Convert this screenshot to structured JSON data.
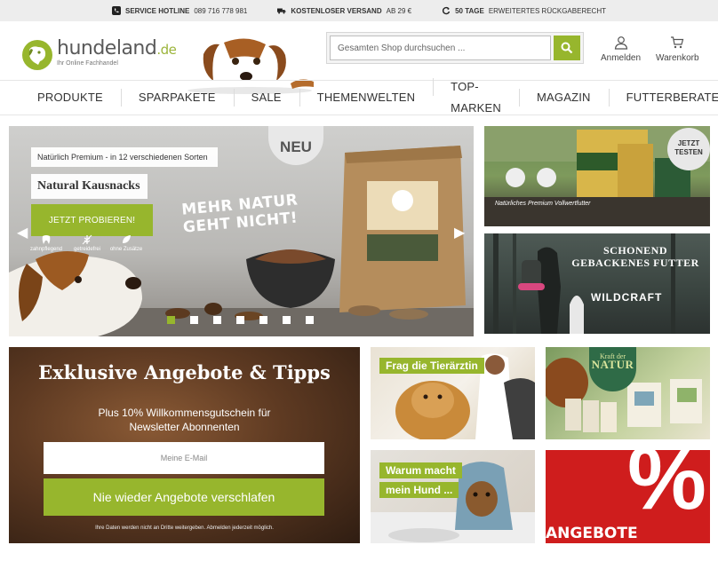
{
  "topbar": {
    "hotline_label": "SERVICE HOTLINE",
    "hotline_number": "089 716 778 981",
    "shipping_label": "KOSTENLOSER VERSAND",
    "shipping_value": "AB 29 €",
    "returns_label": "50 TAGE",
    "returns_value": "ERWEITERTES RÜCKGABERECHT"
  },
  "header": {
    "logo_name": "hundeland",
    "logo_tld": ".de",
    "logo_tagline": "Ihr Online Fachhandel",
    "search_placeholder": "Gesamten Shop durchsuchen ...",
    "login_label": "Anmelden",
    "cart_label": "Warenkorb"
  },
  "nav": {
    "items": [
      "PRODUKTE",
      "SPARPAKETE",
      "SALE",
      "THEMENWELTEN",
      "TOP-MARKEN",
      "MAGAZIN",
      "FUTTERBERATER"
    ]
  },
  "slider": {
    "tagline": "Natürlich Premium - in 12 verschiedenen Sorten",
    "title": "Natural Kausnacks",
    "cta_label": "JETZT PROBIEREN!",
    "features": [
      "zahnpflegend",
      "getreidefrei",
      "ohne Zusätze"
    ],
    "slogan_line1": "MEHR NATUR",
    "slogan_line2": "GEHT NICHT!",
    "badge": "NEU",
    "slide_count": 7,
    "active_slide": 1
  },
  "banners": {
    "native_badge_line1": "JETZT",
    "native_badge_line2": "TESTEN",
    "native_caption": "Natürliches Premium Vollwertfutter",
    "wildcraft_line1": "SCHONEND",
    "wildcraft_line2": "GEBACKENES FUTTER",
    "wildcraft_brand": "WILDCRAFT"
  },
  "newsletter": {
    "title": "Exklusive Angebote & Tipps",
    "subtitle_line1": "Plus 10% Willkommensgutschein für",
    "subtitle_line2": "Newsletter Abonnenten",
    "email_placeholder": "Meine E-Mail",
    "button_label": "Nie wieder Angebote verschlafen",
    "note": "Ihre Daten werden nicht an Dritte weitergeben. Abmelden jederzeit möglich."
  },
  "tiles": {
    "vet_label": "Frag die Tierärztin",
    "why_line1": "Warum macht",
    "why_line2": "mein Hund ...",
    "natur_badge_top": "Kraft der",
    "natur_badge_main": "NATUR",
    "deals_symbol": "%",
    "deals_label": "ANGEBOTE"
  },
  "colors": {
    "brand_green": "#97b62d",
    "deals_red": "#cf1d1d"
  }
}
